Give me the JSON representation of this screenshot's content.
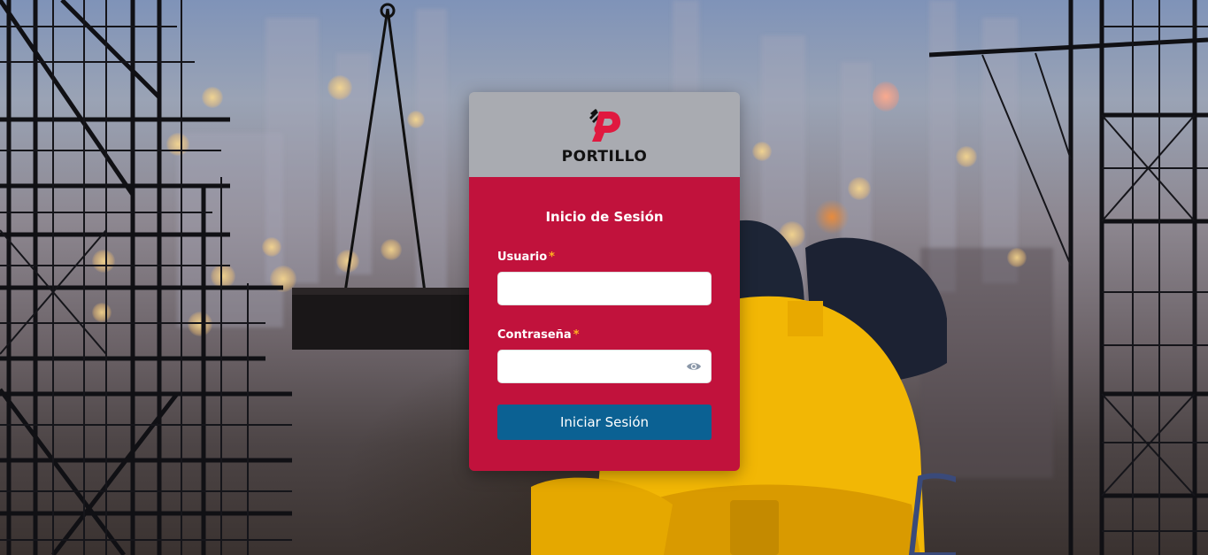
{
  "brand": {
    "name": "PORTILLO",
    "logo_color": "#e0193f"
  },
  "login": {
    "title": "Inicio de Sesión",
    "username_label": "Usuario",
    "password_label": "Contraseña",
    "required_mark": "*",
    "username_value": "",
    "password_value": "",
    "submit_label": "Iniciar Sesión"
  },
  "colors": {
    "header_bg": "#a9abb1",
    "card_bg": "#c1123c",
    "button_bg": "#0b6193",
    "required": "#ffb020"
  },
  "icons": {
    "password_toggle": "eye-icon"
  }
}
